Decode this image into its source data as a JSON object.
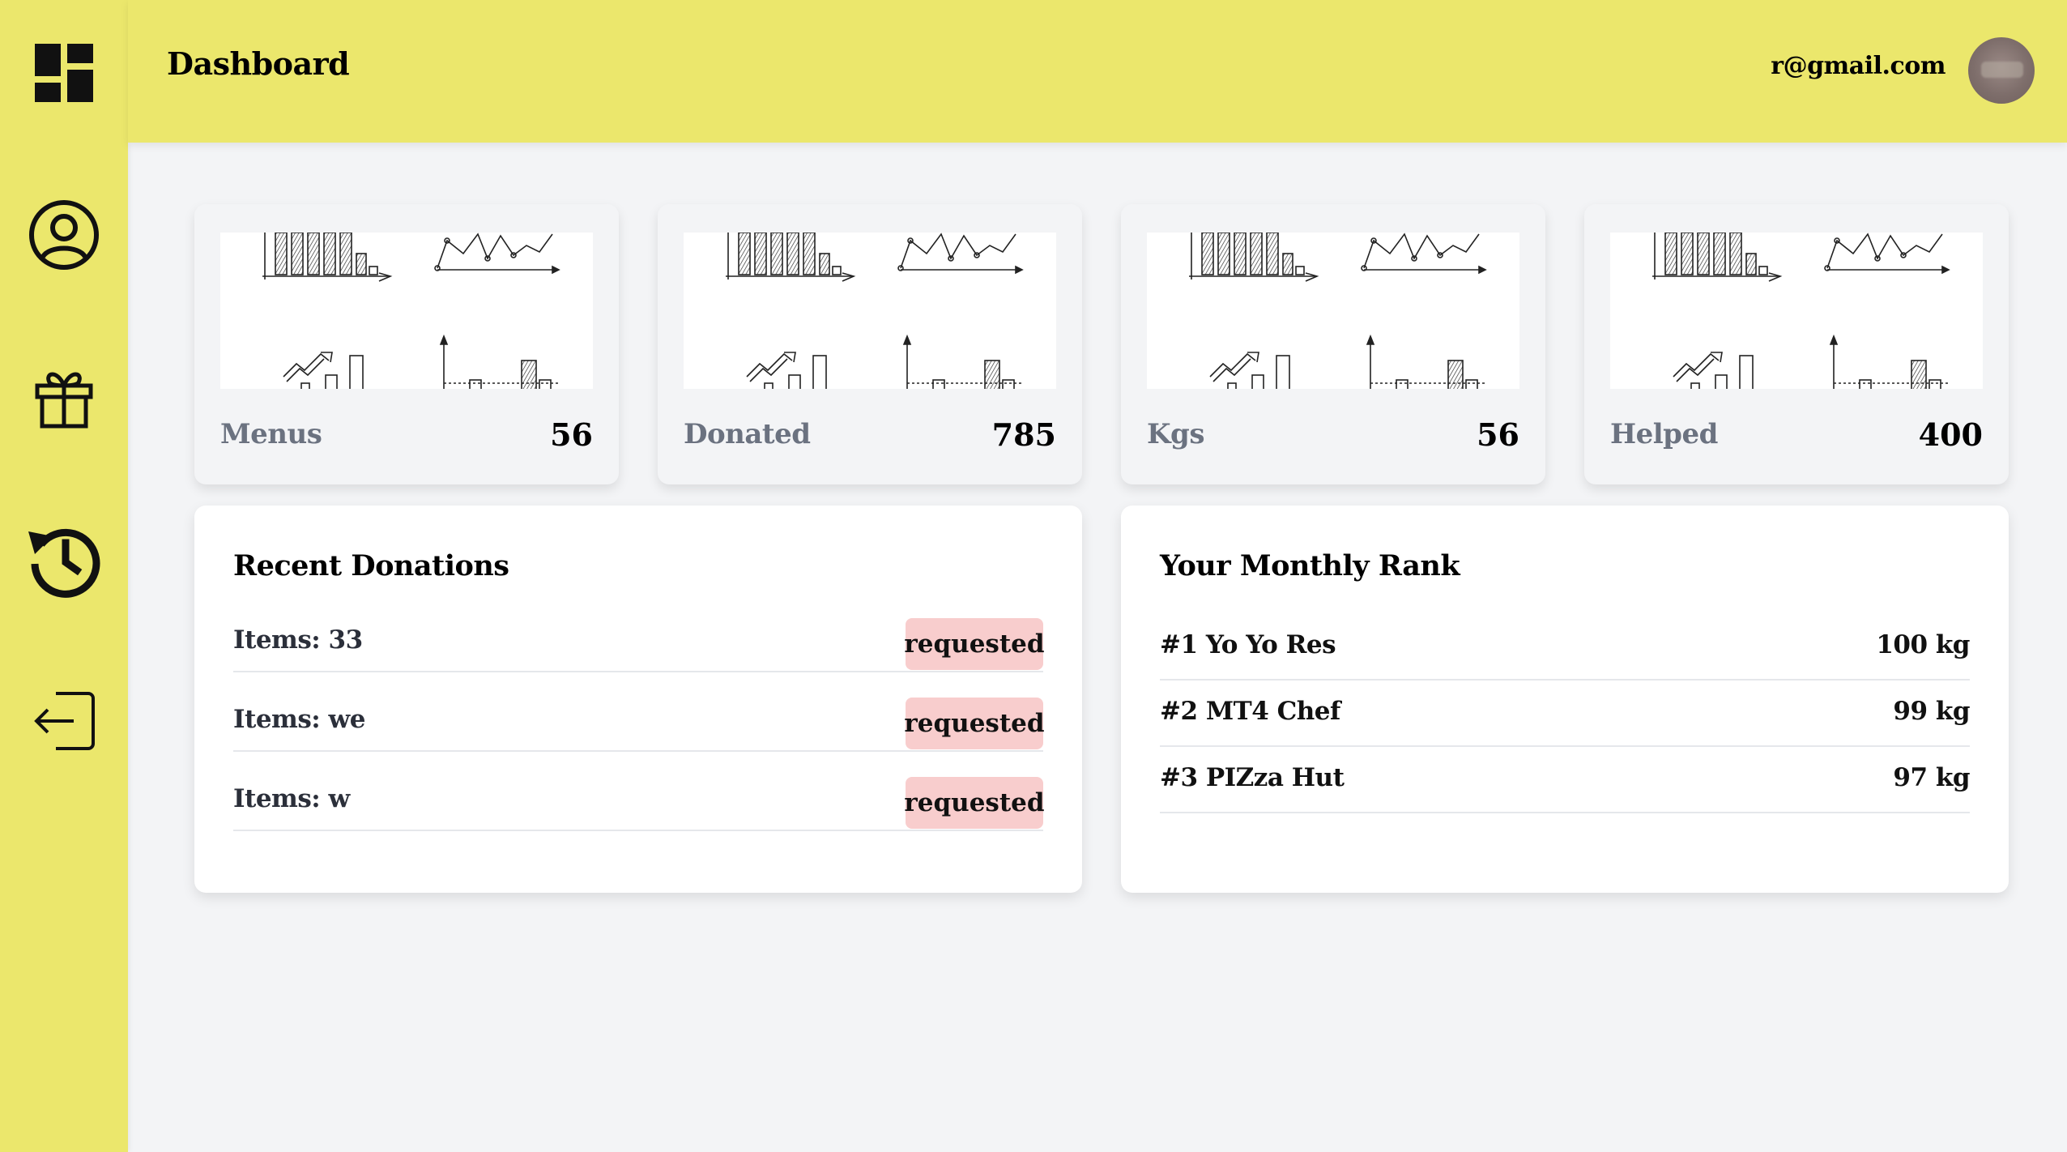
{
  "header": {
    "title": "Dashboard",
    "user_email": "r@gmail.com"
  },
  "sidebar": {
    "items": [
      {
        "icon": "dashboard-icon"
      },
      {
        "icon": "profile-icon"
      },
      {
        "icon": "gift-icon"
      },
      {
        "icon": "history-icon"
      },
      {
        "icon": "logout-icon"
      }
    ]
  },
  "stats": [
    {
      "label": "Menus",
      "value": "56"
    },
    {
      "label": "Donated",
      "value": "785"
    },
    {
      "label": "Kgs",
      "value": "56"
    },
    {
      "label": "Helped",
      "value": "400"
    }
  ],
  "recent": {
    "title": "Recent Donations",
    "rows": [
      {
        "text": "Items: 33",
        "status": "requested"
      },
      {
        "text": "Items: we",
        "status": "requested"
      },
      {
        "text": "Items: w",
        "status": "requested"
      }
    ]
  },
  "rank": {
    "title": "Your Monthly Rank",
    "rows": [
      {
        "name": "#1 Yo Yo Res",
        "value": "100 kg"
      },
      {
        "name": "#2 MT4 Chef",
        "value": "99 kg"
      },
      {
        "name": "#3 PIZza Hut",
        "value": "97 kg"
      }
    ]
  },
  "colors": {
    "accent_yellow": "#ebe76c",
    "badge_pink": "#f8cdcd",
    "background": "#f3f4f6"
  }
}
